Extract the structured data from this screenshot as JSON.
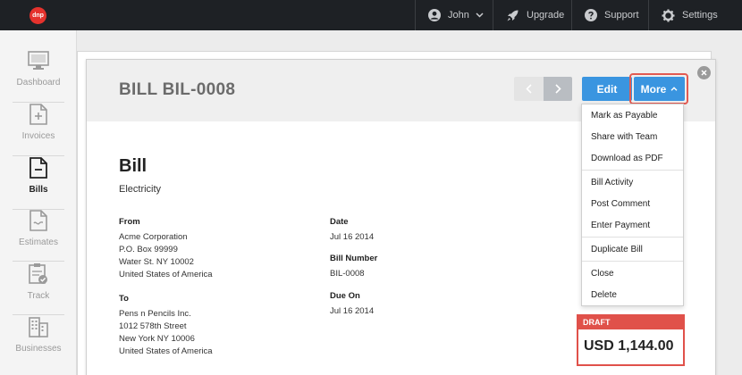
{
  "app": {
    "logo_text": "dnp"
  },
  "topnav": {
    "user": "John",
    "upgrade": "Upgrade",
    "support": "Support",
    "settings": "Settings"
  },
  "sidebar": {
    "items": [
      {
        "label": "Dashboard",
        "icon": "dashboard-icon"
      },
      {
        "label": "Invoices",
        "icon": "invoices-icon"
      },
      {
        "label": "Bills",
        "icon": "bills-icon",
        "active": true
      },
      {
        "label": "Estimates",
        "icon": "estimates-icon"
      },
      {
        "label": "Track",
        "icon": "track-icon"
      },
      {
        "label": "Businesses",
        "icon": "businesses-icon"
      }
    ]
  },
  "header": {
    "title": "BILL BIL-0008",
    "edit_label": "Edit",
    "more_label": "More"
  },
  "bill": {
    "heading": "Bill",
    "subtitle": "Electricity",
    "from_label": "From",
    "from_lines": [
      "Acme Corporation",
      "P.O. Box 99999",
      "Water St. NY 10002",
      "United States of America"
    ],
    "to_label": "To",
    "to_lines": [
      "Pens n Pencils Inc.",
      "1012 578th Street",
      "New York NY 10006",
      "United States of America"
    ],
    "date_label": "Date",
    "date_value": "Jul 16 2014",
    "number_label": "Bill Number",
    "number_value": "BIL-0008",
    "due_label": "Due On",
    "due_value": "Jul 16 2014"
  },
  "more_menu": {
    "items": [
      "Mark as Payable",
      "Share with Team",
      "Download as PDF",
      "Bill Activity",
      "Post Comment",
      "Enter Payment",
      "Duplicate Bill",
      "Close",
      "Delete"
    ]
  },
  "total": {
    "status": "DRAFT",
    "amount": "USD 1,144.00"
  },
  "colors": {
    "accent": "#3a95e0",
    "danger": "#e0514a",
    "topbar": "#1e2125"
  }
}
